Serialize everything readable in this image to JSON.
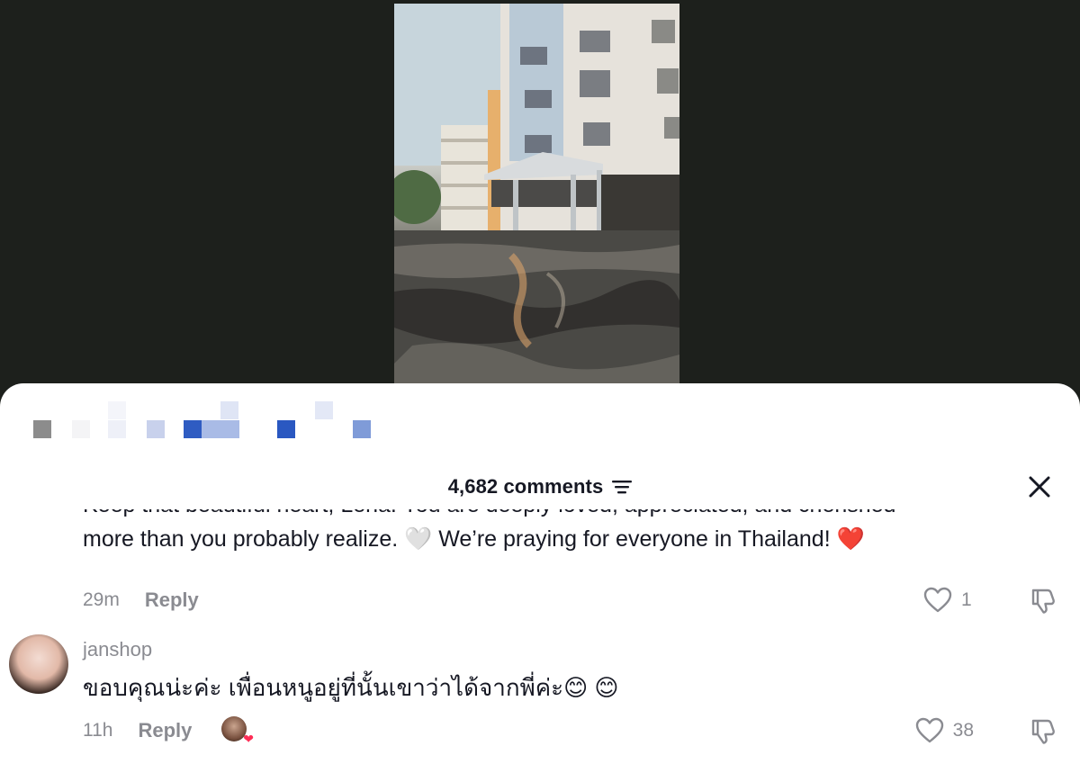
{
  "video": {
    "description_icon": "flooded-apartment-video"
  },
  "header": {
    "comments_label": "4,682 comments",
    "sort_icon": "sort-icon",
    "close_icon": "close-icon"
  },
  "comments": [
    {
      "text_line1": "Keep that beautiful heart, Lena. You are deeply loved, appreciated, and cherished",
      "text_line2": "more than you probably realize. 🤍 We’re praying for everyone in Thailand! ❤️",
      "time": "29m",
      "reply_label": "Reply",
      "likes": "1"
    },
    {
      "username": "janshop",
      "text": "ขอบคุณน่ะค่ะ เพื่อนหนูอยู่ที่นั้นเขาว่าได้จากพี่ค่ะ😊 😊",
      "time": "11h",
      "reply_label": "Reply",
      "likes": "38",
      "creator_liked": true
    }
  ],
  "colors": {
    "background": "#1d201c",
    "sheet": "#ffffff",
    "muted": "#8a8b91",
    "heart_accent": "#fe2c55"
  }
}
